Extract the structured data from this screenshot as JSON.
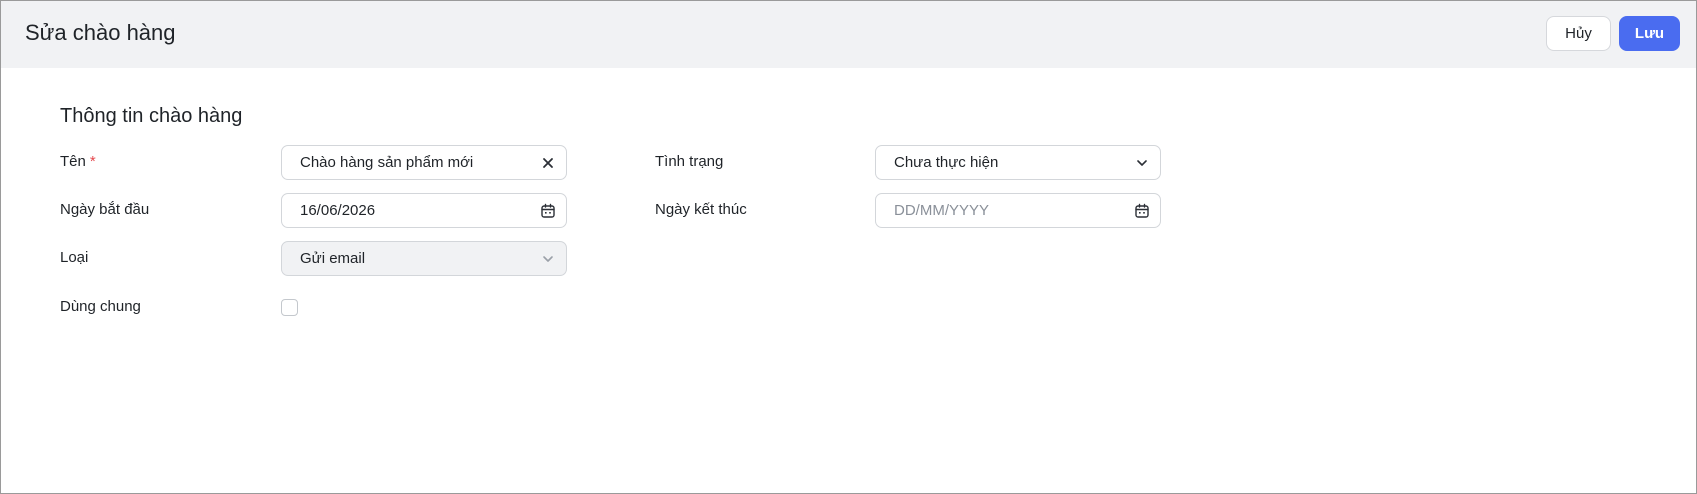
{
  "header": {
    "title": "Sửa chào hàng",
    "cancel_label": "Hủy",
    "save_label": "Lưu",
    "accent_color": "#4a6cf0"
  },
  "form": {
    "section_title": "Thông tin chào hàng",
    "name": {
      "label": "Tên",
      "required_mark": "*",
      "value": "Chào hàng sản phẩm mới",
      "icon": "clear-icon"
    },
    "status": {
      "label": "Tình trạng",
      "value": "Chưa thực hiện",
      "icon": "chevron-down-icon"
    },
    "start_date": {
      "label": "Ngày bắt đầu",
      "value": "16/06/2026",
      "icon": "calendar-icon"
    },
    "end_date": {
      "label": "Ngày kết thúc",
      "placeholder": "DD/MM/YYYY",
      "icon": "calendar-icon"
    },
    "type": {
      "label": "Loại",
      "value": "Gửi email",
      "icon": "chevron-down-icon",
      "disabled": true
    },
    "shared": {
      "label": "Dùng chung",
      "checked": false
    }
  }
}
